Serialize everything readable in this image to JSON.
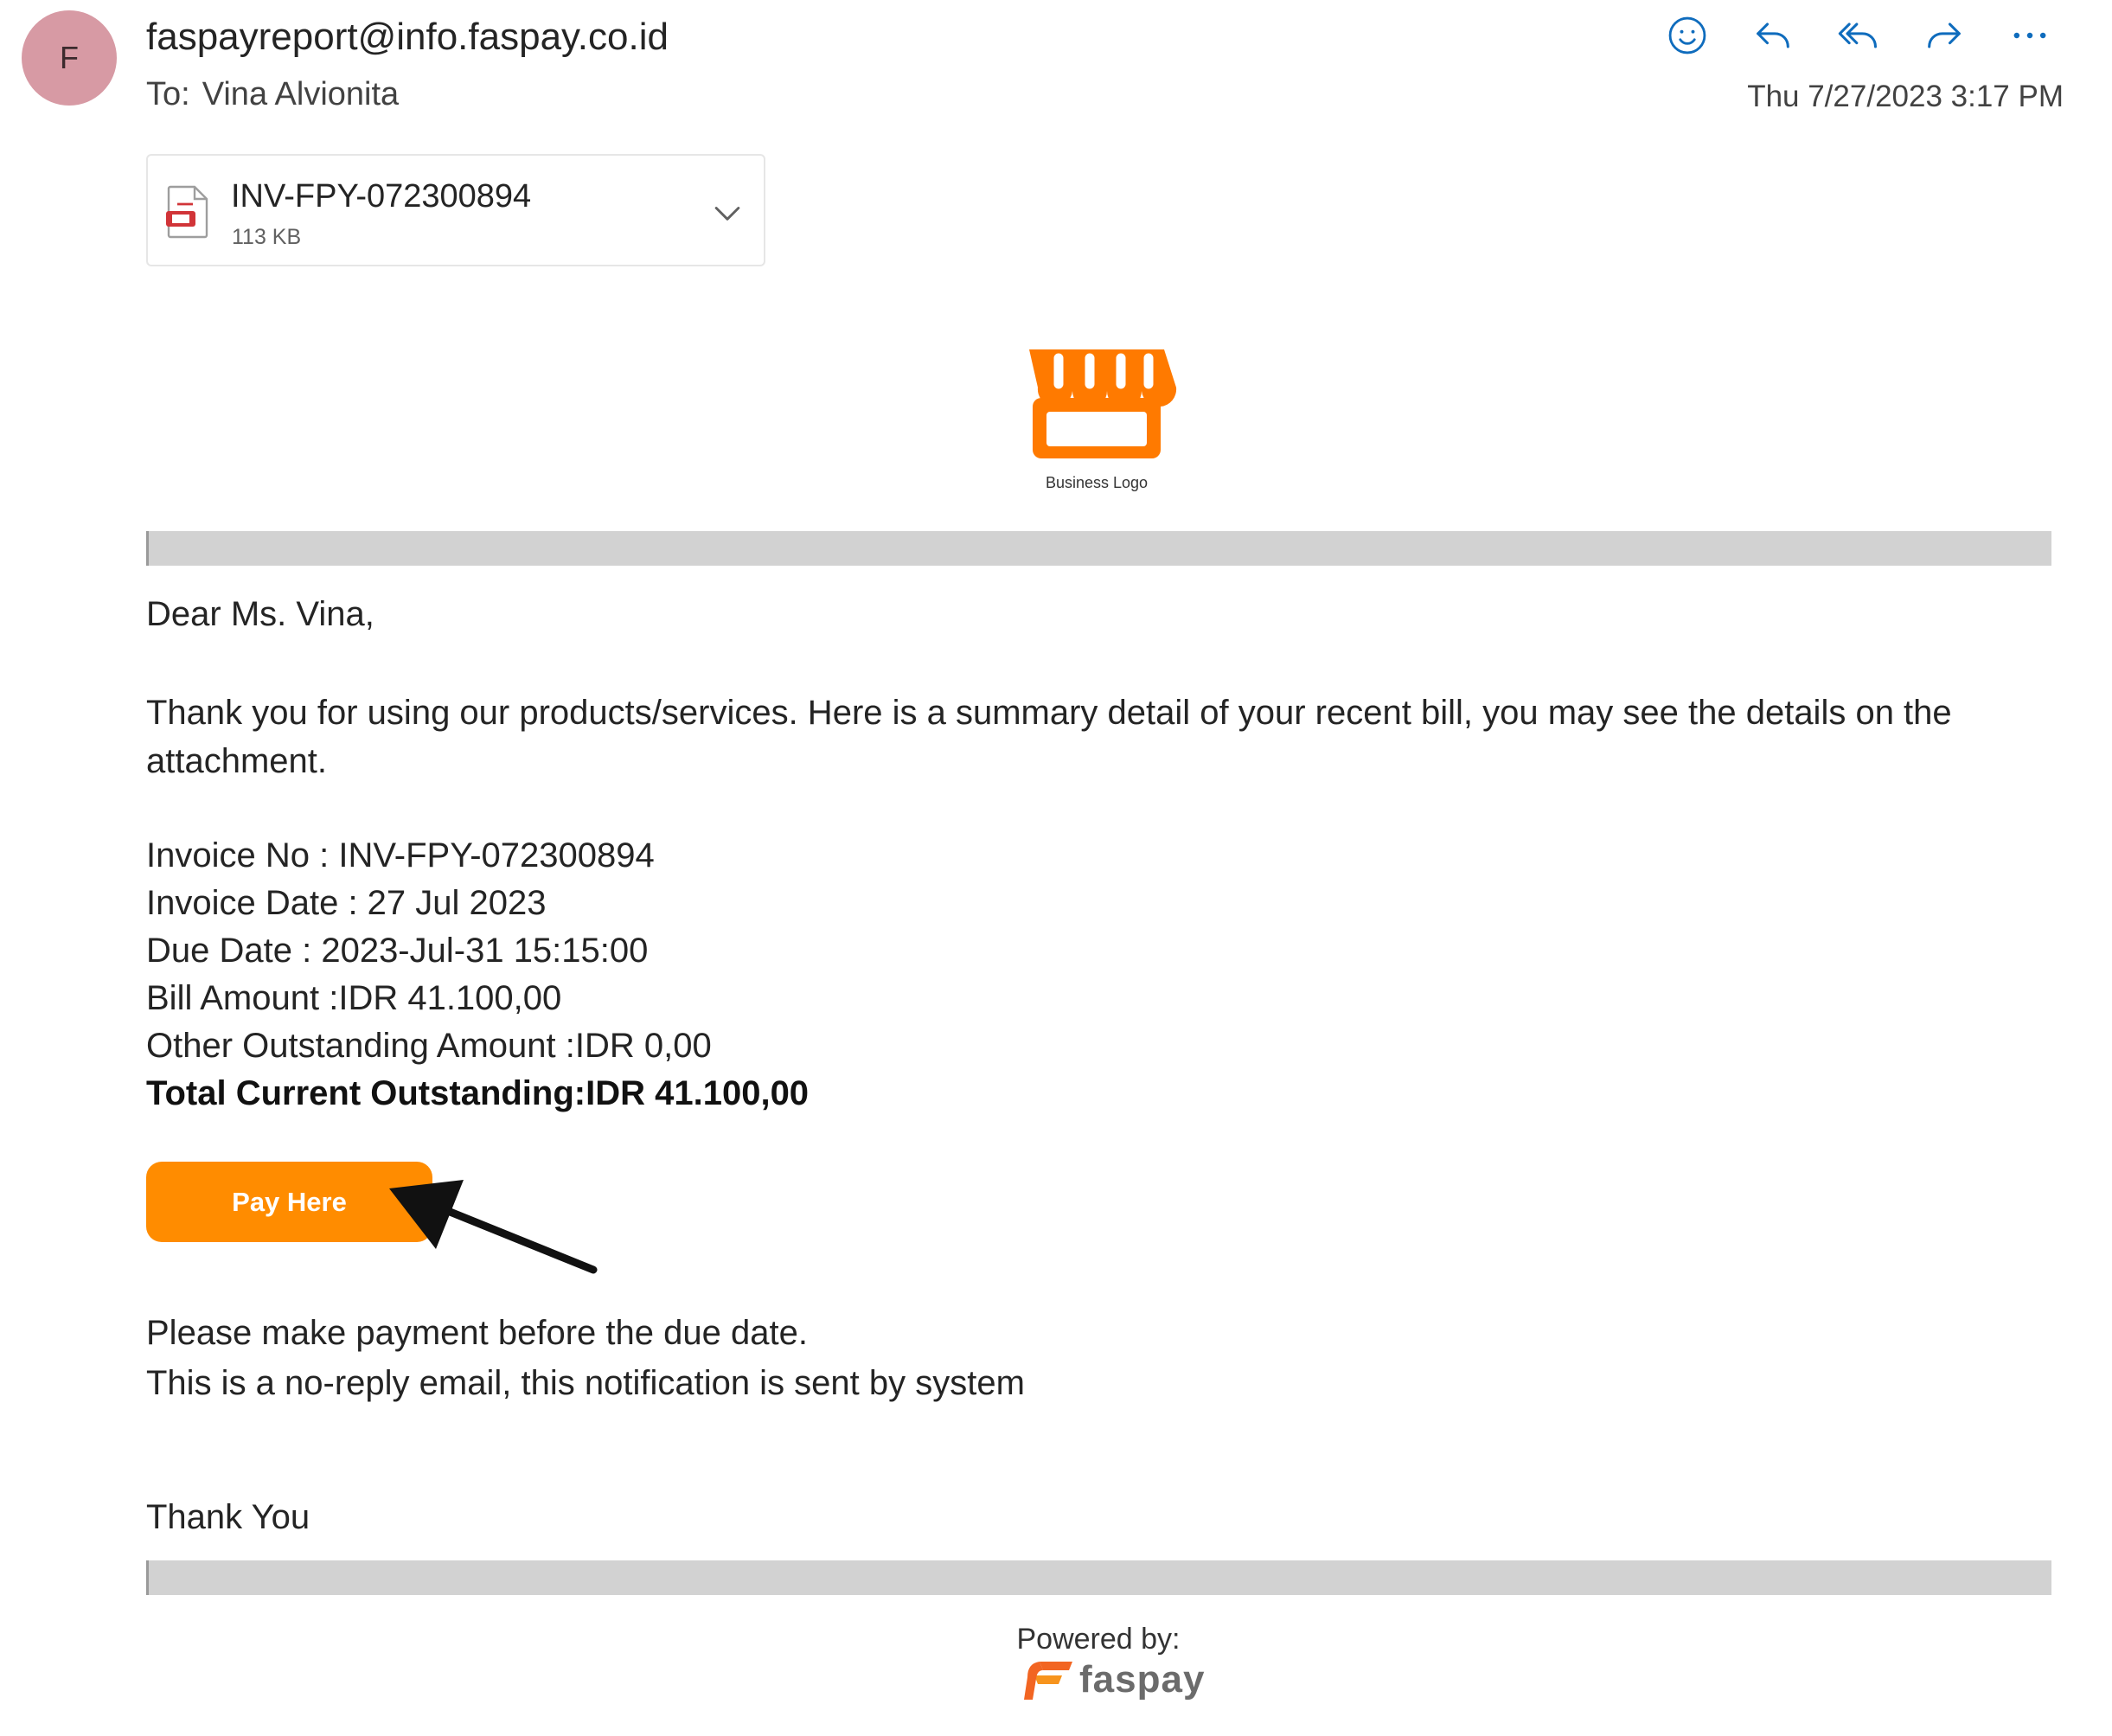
{
  "email": {
    "avatar_initial": "F",
    "sender": "faspayreport@info.faspay.co.id",
    "to_label": "To:",
    "to_name": "Vina Alvionita",
    "datetime": "Thu 7/27/2023 3:17 PM",
    "actions": [
      {
        "name": "react",
        "icon": "smiley-icon"
      },
      {
        "name": "reply",
        "icon": "reply-icon"
      },
      {
        "name": "reply-all",
        "icon": "reply-all-icon"
      },
      {
        "name": "forward",
        "icon": "forward-icon"
      },
      {
        "name": "more",
        "icon": "more-icon"
      }
    ],
    "accent_color": "#0f6cbd"
  },
  "attachment": {
    "filename": "INV-FPY-072300894",
    "size": "113 KB",
    "icon": "pdf-file-icon"
  },
  "message": {
    "logo_caption": "Business Logo",
    "greeting": "Dear Ms. Vina,",
    "intro": "Thank you for using our products/services. Here is a summary detail of your recent bill, you may see the details on the attachment.",
    "invoice_no": "Invoice No : INV-FPY-072300894",
    "invoice_date": "Invoice Date : 27 Jul 2023",
    "due_date": "Due Date : 2023-Jul-31 15:15:00",
    "bill_amount": "Bill Amount :IDR 41.100,00",
    "other_outstanding": "Other Outstanding Amount :IDR 0,00",
    "total_outstanding": "Total Current Outstanding:IDR 41.100,00",
    "pay_button": "Pay Here",
    "pay_button_color": "#ff8c00",
    "note_1": "Please make payment before the due date.",
    "note_2": "This is a no-reply email, this notification is sent by system",
    "closing": "Thank You",
    "powered_by": "Powered by:",
    "brand_name": "faspay"
  }
}
